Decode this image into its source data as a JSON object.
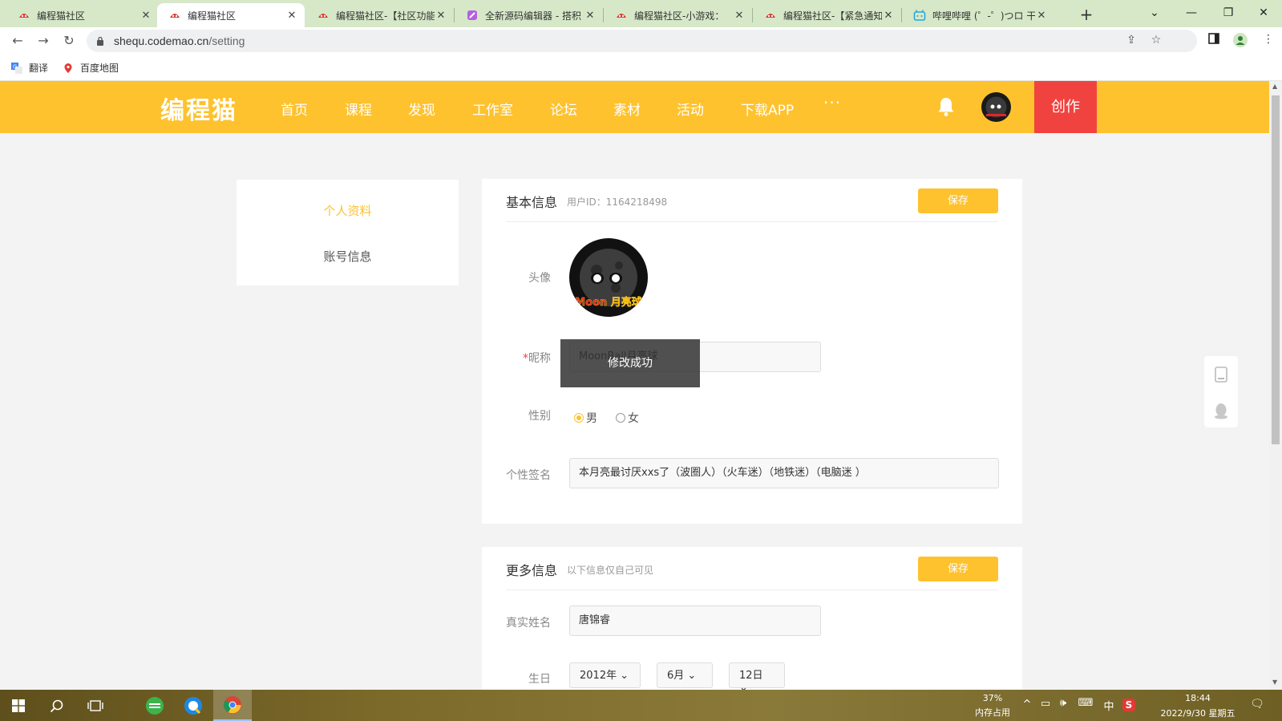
{
  "browser": {
    "tabs": [
      {
        "title": "编程猫社区",
        "active": false
      },
      {
        "title": "编程猫社区",
        "active": true
      },
      {
        "title": "编程猫社区-【社区功能",
        "active": false
      },
      {
        "title": "全新源码编辑器 - 搭积",
        "active": false
      },
      {
        "title": "编程猫社区-小游戏：",
        "active": false
      },
      {
        "title": "编程猫社区-【紧急通知",
        "active": false
      },
      {
        "title": "哔哩哔哩 (゜-゜)つロ 干",
        "active": false
      }
    ],
    "url_domain": "shequ.codemao.cn",
    "url_path": "/setting",
    "bookmarks": [
      "翻译",
      "百度地图"
    ]
  },
  "site": {
    "logo": "编程猫",
    "nav": [
      "首页",
      "课程",
      "发现",
      "工作室",
      "论坛",
      "素材",
      "活动",
      "下载APP"
    ],
    "more": "···",
    "create_label": "创作"
  },
  "sidebar": {
    "items": [
      "个人资料",
      "账号信息"
    ]
  },
  "basic_info": {
    "title": "基本信息",
    "user_id": "用户ID：1164218498",
    "save_label": "保存",
    "avatar_label": "头像",
    "avatar_text": "Moon 月亮球",
    "nickname_required_mark": "*",
    "nickname_label": "昵称",
    "nickname_value": "MoonBall月亮球",
    "gender_label": "性别",
    "gender_options": [
      "男",
      "女"
    ],
    "gender_selected": "男",
    "signature_label": "个性签名",
    "signature_value": "本月亮最讨厌xxs了（波圈人）（火车迷）（地铁迷）（电脑迷 ）"
  },
  "toast": "修改成功",
  "more_info": {
    "title": "更多信息",
    "subtitle": "以下信息仅自己可见",
    "save_label": "保存",
    "realname_label": "真实姓名",
    "realname_value": "唐锦睿",
    "birthday_label": "生日",
    "birthday_year": "2012年",
    "birthday_month": "6月",
    "birthday_day": "12日"
  },
  "taskbar": {
    "memory_percent": "37%",
    "memory_label": "内存占用",
    "ime": "中",
    "time": "18:44",
    "date": "2022/9/30 星期五"
  },
  "colors": {
    "brand_yellow": "#fec22e",
    "create_red": "#f0433f",
    "tab_bar": "#d6e8c8"
  }
}
